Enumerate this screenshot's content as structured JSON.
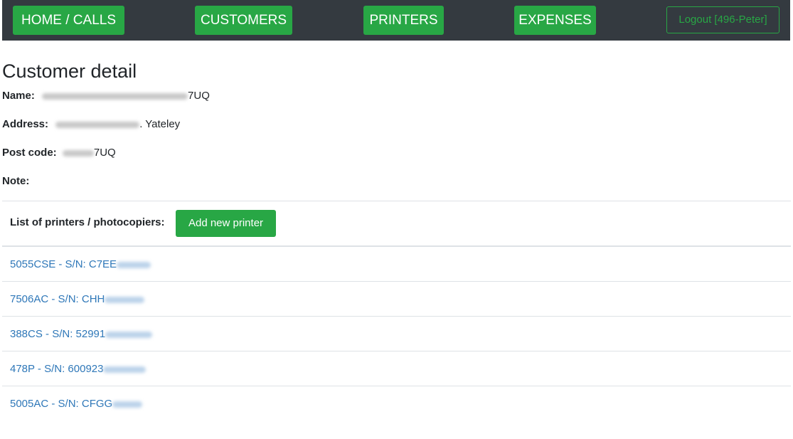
{
  "nav": {
    "home": "HOME / CALLS",
    "customers": "CUSTOMERS",
    "printers": "PRINTERS",
    "expenses": "EXPENSES",
    "logout": "Logout [496-Peter]"
  },
  "page_title": "Customer detail",
  "customer": {
    "name_label": "Name:",
    "name_value": "7UQ",
    "address_label": "Address:",
    "address_value": ". Yateley",
    "postcode_label": "Post code:",
    "postcode_value": "7UQ",
    "note_label": "Note:",
    "note_value": ""
  },
  "printers": {
    "list_label": "List of printers / photocopiers:",
    "add_button": "Add new printer",
    "items": [
      {
        "label": "5055CSE - S/N: C7EE"
      },
      {
        "label": "7506AC - S/N: CHH"
      },
      {
        "label": "388CS - S/N: 52991"
      },
      {
        "label": "478P - S/N: 600923"
      },
      {
        "label": "5005AC - S/N: CFGG"
      }
    ]
  },
  "colors": {
    "navbar_bg": "#343a40",
    "accent_green": "#28a745",
    "link_blue": "#2e77b8"
  }
}
